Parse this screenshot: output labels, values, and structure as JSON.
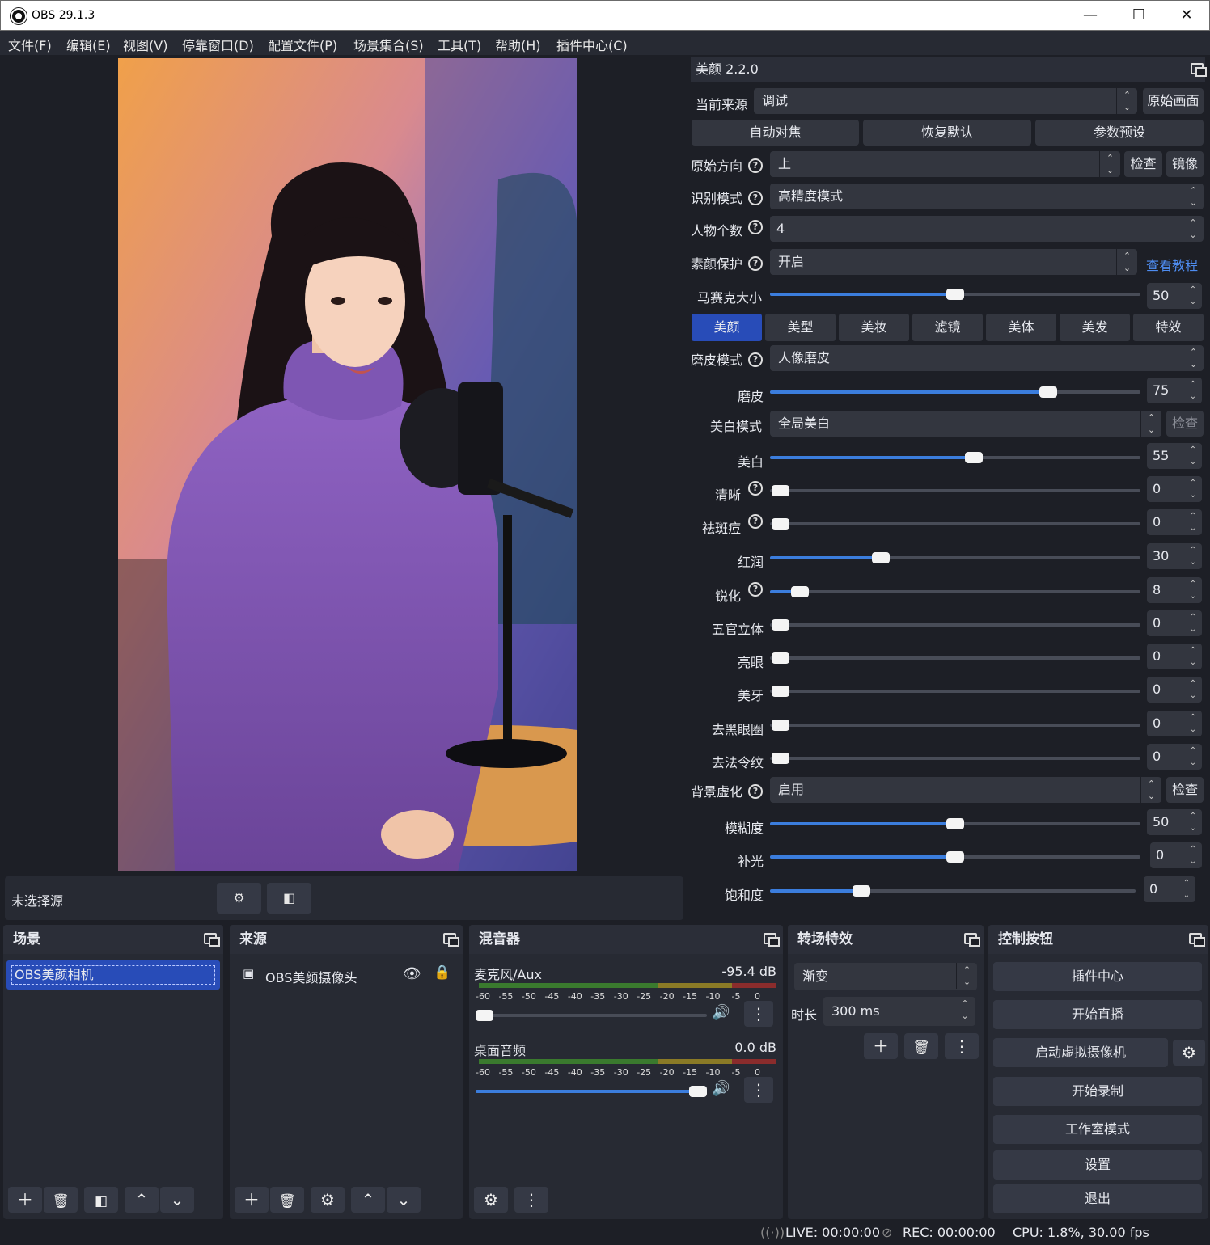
{
  "window": {
    "title": "OBS 29.1.3",
    "minimize": "—",
    "maximize": "☐",
    "close": "✕"
  },
  "menu": [
    "文件(F)",
    "编辑(E)",
    "视图(V)",
    "停靠窗口(D)",
    "配置文件(P)",
    "场景集合(S)",
    "工具(T)",
    "帮助(H)",
    "插件中心(C)"
  ],
  "source_bar": {
    "label": "未选择源"
  },
  "beauty": {
    "title": "美颜 2.2.0",
    "current_source_label": "当前来源",
    "current_source_value": "调试",
    "original_btn": "原始画面",
    "btn_autofocus": "自动对焦",
    "btn_restore": "恢复默认",
    "btn_presets": "参数预设",
    "orientation_label": "原始方向",
    "orientation_value": "上",
    "check": "检查",
    "mirror": "镜像",
    "detect_label": "识别模式",
    "detect_value": "高精度模式",
    "persons_label": "人物个数",
    "persons_value": "4",
    "protect_label": "素颜保护",
    "protect_value": "开启",
    "tutorial": "查看教程",
    "mosaic_label": "马赛克大小",
    "mosaic_value": "50",
    "tabs": [
      "美颜",
      "美型",
      "美妆",
      "滤镜",
      "美体",
      "美发",
      "特效"
    ],
    "smooth_mode_label": "磨皮模式",
    "smooth_mode_value": "人像磨皮",
    "whiten_mode_label": "美白模式",
    "whiten_mode_value": "全局美白",
    "blur_label": "背景虚化",
    "blur_value": "启用",
    "sliders": [
      {
        "label": "磨皮",
        "value": "75",
        "level": 0.75
      },
      {
        "label": "美白",
        "value": "55",
        "level": 0.55
      },
      {
        "label": "清晰",
        "value": "0",
        "level": 0
      },
      {
        "label": "祛斑痘",
        "value": "0",
        "level": 0
      },
      {
        "label": "红润",
        "value": "30",
        "level": 0.3
      },
      {
        "label": "锐化",
        "value": "8",
        "level": 0.08
      },
      {
        "label": "五官立体",
        "value": "0",
        "level": 0
      },
      {
        "label": "亮眼",
        "value": "0",
        "level": 0
      },
      {
        "label": "美牙",
        "value": "0",
        "level": 0
      },
      {
        "label": "去黑眼圈",
        "value": "0",
        "level": 0
      },
      {
        "label": "去法令纹",
        "value": "0",
        "level": 0
      },
      {
        "label": "模糊度",
        "value": "50",
        "level": 0.5
      },
      {
        "label": "补光",
        "value": "0",
        "level": 0.5
      },
      {
        "label": "饱和度",
        "value": "0",
        "level": 0.25
      }
    ]
  },
  "scenes": {
    "title": "场景",
    "items": [
      "OBS美颜相机"
    ]
  },
  "sources": {
    "title": "来源",
    "items": [
      "OBS美颜摄像头"
    ]
  },
  "mixer": {
    "title": "混音器",
    "channels": [
      {
        "name": "麦克风/Aux",
        "db": "-95.4 dB",
        "level": 0.0
      },
      {
        "name": "桌面音频",
        "db": "0.0 dB",
        "level": 1.0
      }
    ],
    "ticks": "-60   -55   -50   -45   -40   -35   -30   -25   -20   -15   -10    -5     0"
  },
  "transitions": {
    "title": "转场特效",
    "type": "渐变",
    "duration_label": "时长",
    "duration": "300 ms"
  },
  "controls": {
    "title": "控制按钮",
    "plugin_center": "插件中心",
    "start_stream": "开始直播",
    "start_virtualcam": "启动虚拟摄像机",
    "start_record": "开始录制",
    "studio_mode": "工作室模式",
    "settings": "设置",
    "exit": "退出"
  },
  "status": {
    "live": "LIVE: 00:00:00",
    "rec": "REC: 00:00:00",
    "cpu": "CPU: 1.8%, 30.00 fps"
  },
  "colors": {
    "accent": "#3b7ddd",
    "active_tab": "#284cb8",
    "bg": "#1d1f26",
    "link": "#4e8cf0"
  }
}
